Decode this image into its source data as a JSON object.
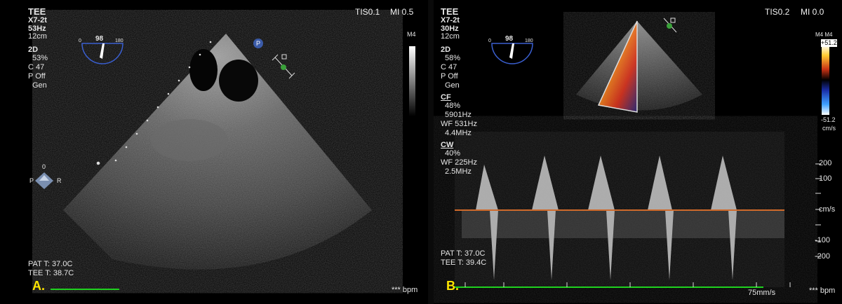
{
  "left": {
    "header": {
      "mode": "TEE",
      "probe": "X7-2t",
      "freq": "53Hz",
      "depth": "12cm"
    },
    "params": [
      "2D",
      "53%",
      "C 47",
      "P Off",
      "Gen"
    ],
    "tis": "TIS0.1",
    "mi": "MI 0.5",
    "grey_map": "M4",
    "angle": {
      "value": "98",
      "min": "0",
      "max": "180"
    },
    "orient": {
      "top": "0",
      "left": "P",
      "right": "R"
    },
    "badge": "P",
    "temps": [
      "PAT T: 37.0C",
      "TEE T: 38.7C"
    ],
    "marker": "A.",
    "bpm": "*** bpm"
  },
  "right": {
    "header": {
      "mode": "TEE",
      "probe": "X7-2t",
      "freq": "30Hz",
      "depth": "12cm"
    },
    "params_2d": [
      "2D",
      "58%",
      "C 47",
      "P Off",
      "Gen"
    ],
    "params_cf": [
      "CF",
      "48%",
      "5901Hz",
      "WF 531Hz",
      "4.4MHz"
    ],
    "params_cw": [
      "CW",
      "40%",
      "WF 225Hz",
      "2.5MHz"
    ],
    "tis": "TIS0.2",
    "mi": "MI 0.0",
    "angle": {
      "value": "98",
      "min": "0",
      "max": "180"
    },
    "color_bar": {
      "label": "M4 M4",
      "top": "+51.2",
      "bottom": "-51.2",
      "unit": "cm/s"
    },
    "velocity_scale": [
      "200",
      "100",
      "cm/s",
      "-100",
      "-200"
    ],
    "temps": [
      "PAT T: 37.0C",
      "TEE T: 39.4C"
    ],
    "marker": "B.",
    "sweep": "75mm/s",
    "bpm": "*** bpm"
  },
  "colors": {
    "marker": "#ffe500",
    "ecg": "#1fd21f",
    "baseline": "#d06a2a",
    "angle_dial": "#3a5fd0"
  }
}
